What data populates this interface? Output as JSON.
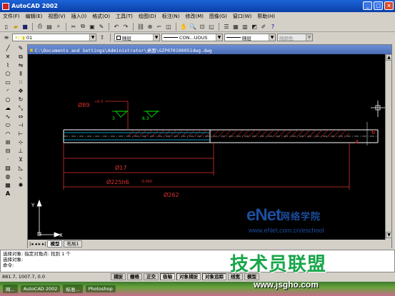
{
  "app": {
    "title": "AutoCAD 2002"
  },
  "menu": [
    "文件(F)",
    "编辑(E)",
    "视图(V)",
    "插入(I)",
    "格式(O)",
    "工具(T)",
    "绘图(D)",
    "标注(N)",
    "修改(M)",
    "图像(G)",
    "窗口(W)",
    "帮助(H)"
  ],
  "properties": {
    "layer": "01",
    "color": "随层",
    "linetype": "CON...UOUS",
    "lineweight": "随层",
    "plotstyle": "随颜色"
  },
  "drawing": {
    "title": "C:\\Documents and Settings\\Administrator\\桌面\\GZP070100051dwg.dwg",
    "dims": {
      "d1": "Ø89",
      "d1_tol": "+0.3",
      "d2": "Ø17",
      "d3": "Ø225h6",
      "d3_tol": "-0.050",
      "d4": "Ø262",
      "r1": "6",
      "r2": "4",
      "s1": "3",
      "s2": "6.3"
    },
    "tabs": [
      "模型",
      "布局1"
    ],
    "ucs": {
      "x": "X",
      "y": "Y"
    }
  },
  "command": {
    "lines": [
      "选择对象: 指定对角点: 找到 1 个",
      "选择对象:",
      "命令:"
    ]
  },
  "status": {
    "coords": "881.7, 1007.7, 0.0",
    "buttons": [
      "捕捉",
      "栅格",
      "正交",
      "极轴",
      "对象捕捉",
      "对象追踪",
      "线宽",
      "模型"
    ]
  },
  "taskbar": {
    "items": [
      "网...",
      "AutoCAD 2002",
      "标准...",
      "Photoshop"
    ]
  },
  "watermarks": {
    "enet": "eNet",
    "enet_cn": "网络学院",
    "enet_url": "www.eNet.com.cn/eschool",
    "jsgho": "技术员联盟",
    "jsgho_url": "www.jsgho.com"
  }
}
